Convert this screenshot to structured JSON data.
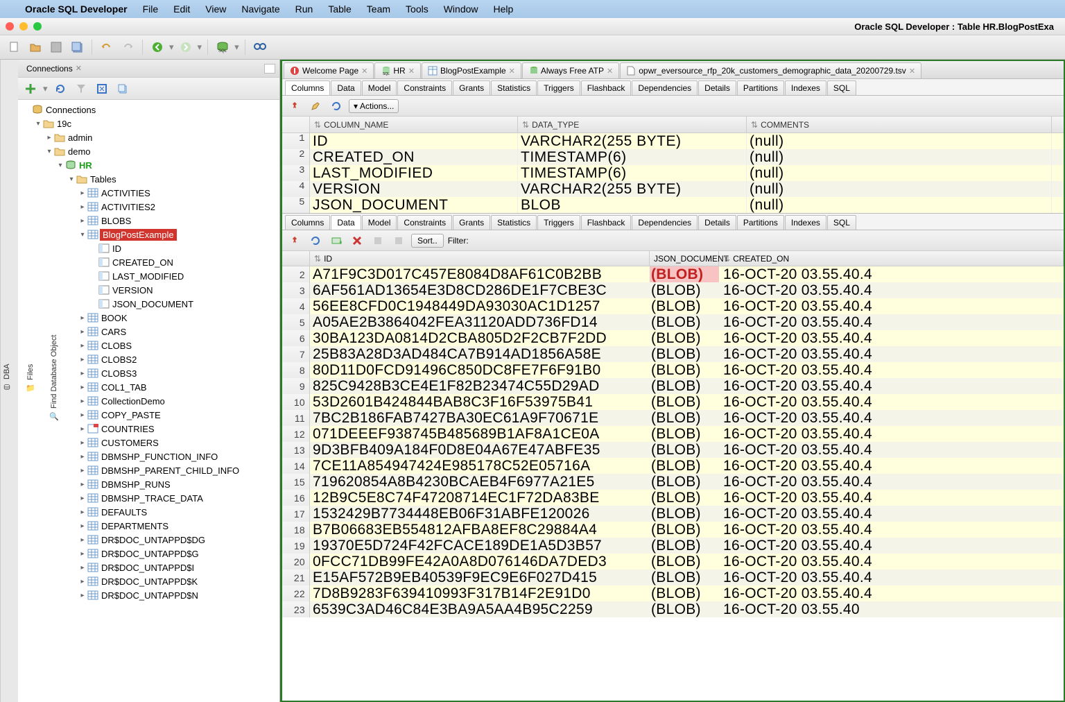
{
  "menubar": {
    "app": "Oracle SQL Developer",
    "items": [
      "File",
      "Edit",
      "View",
      "Navigate",
      "Run",
      "Table",
      "Team",
      "Tools",
      "Window",
      "Help"
    ]
  },
  "window": {
    "title": "Oracle SQL Developer : Table HR.BlogPostExa"
  },
  "leftRail": [
    "Find Database Object",
    "Files",
    "DBA"
  ],
  "connectionsPanel": {
    "title": "Connections"
  },
  "tree": [
    {
      "d": 0,
      "tw": "",
      "icon": "db",
      "label": "Connections",
      "cls": ""
    },
    {
      "d": 1,
      "tw": "▾",
      "icon": "folder",
      "label": "19c"
    },
    {
      "d": 2,
      "tw": "▸",
      "icon": "folder",
      "label": "admin"
    },
    {
      "d": 2,
      "tw": "▾",
      "icon": "folder",
      "label": "demo"
    },
    {
      "d": 3,
      "tw": "▾",
      "icon": "schema",
      "label": "HR",
      "cls": "schema-label"
    },
    {
      "d": 4,
      "tw": "▾",
      "icon": "folder-tbl",
      "label": "Tables"
    },
    {
      "d": 5,
      "tw": "▸",
      "icon": "table",
      "label": "ACTIVITIES"
    },
    {
      "d": 5,
      "tw": "▸",
      "icon": "table",
      "label": "ACTIVITIES2"
    },
    {
      "d": 5,
      "tw": "▸",
      "icon": "table",
      "label": "BLOBS"
    },
    {
      "d": 5,
      "tw": "▾",
      "icon": "table",
      "label": "BlogPostExample",
      "sel": true
    },
    {
      "d": 6,
      "tw": "",
      "icon": "col",
      "label": "ID"
    },
    {
      "d": 6,
      "tw": "",
      "icon": "col",
      "label": "CREATED_ON"
    },
    {
      "d": 6,
      "tw": "",
      "icon": "col",
      "label": "LAST_MODIFIED"
    },
    {
      "d": 6,
      "tw": "",
      "icon": "col",
      "label": "VERSION"
    },
    {
      "d": 6,
      "tw": "",
      "icon": "col",
      "label": "JSON_DOCUMENT"
    },
    {
      "d": 5,
      "tw": "▸",
      "icon": "table",
      "label": "BOOK"
    },
    {
      "d": 5,
      "tw": "▸",
      "icon": "table",
      "label": "CARS"
    },
    {
      "d": 5,
      "tw": "▸",
      "icon": "table",
      "label": "CLOBS"
    },
    {
      "d": 5,
      "tw": "▸",
      "icon": "table",
      "label": "CLOBS2"
    },
    {
      "d": 5,
      "tw": "▸",
      "icon": "table",
      "label": "CLOBS3"
    },
    {
      "d": 5,
      "tw": "▸",
      "icon": "table",
      "label": "COL1_TAB"
    },
    {
      "d": 5,
      "tw": "▸",
      "icon": "table",
      "label": "CollectionDemo"
    },
    {
      "d": 5,
      "tw": "▸",
      "icon": "table",
      "label": "COPY_PASTE"
    },
    {
      "d": 5,
      "tw": "▸",
      "icon": "table-flag",
      "label": "COUNTRIES"
    },
    {
      "d": 5,
      "tw": "▸",
      "icon": "table",
      "label": "CUSTOMERS"
    },
    {
      "d": 5,
      "tw": "▸",
      "icon": "table",
      "label": "DBMSHP_FUNCTION_INFO"
    },
    {
      "d": 5,
      "tw": "▸",
      "icon": "table",
      "label": "DBMSHP_PARENT_CHILD_INFO"
    },
    {
      "d": 5,
      "tw": "▸",
      "icon": "table",
      "label": "DBMSHP_RUNS"
    },
    {
      "d": 5,
      "tw": "▸",
      "icon": "table",
      "label": "DBMSHP_TRACE_DATA"
    },
    {
      "d": 5,
      "tw": "▸",
      "icon": "table",
      "label": "DEFAULTS"
    },
    {
      "d": 5,
      "tw": "▸",
      "icon": "table",
      "label": "DEPARTMENTS"
    },
    {
      "d": 5,
      "tw": "▸",
      "icon": "table",
      "label": "DR$DOC_UNTAPPD$DG"
    },
    {
      "d": 5,
      "tw": "▸",
      "icon": "table",
      "label": "DR$DOC_UNTAPPD$G"
    },
    {
      "d": 5,
      "tw": "▸",
      "icon": "table",
      "label": "DR$DOC_UNTAPPD$I"
    },
    {
      "d": 5,
      "tw": "▸",
      "icon": "table",
      "label": "DR$DOC_UNTAPPD$K"
    },
    {
      "d": 5,
      "tw": "▸",
      "icon": "table",
      "label": "DR$DOC_UNTAPPD$N"
    }
  ],
  "editorTabs": [
    {
      "icon": "welcome",
      "label": "Welcome Page"
    },
    {
      "icon": "sql",
      "label": "HR"
    },
    {
      "icon": "table",
      "label": "BlogPostExample"
    },
    {
      "icon": "sql-green",
      "label": "Always Free ATP"
    },
    {
      "icon": "file",
      "label": "opwr_eversource_rfp_20k_customers_demographic_data_20200729.tsv"
    }
  ],
  "subTabs": [
    "Columns",
    "Data",
    "Model",
    "Constraints",
    "Grants",
    "Statistics",
    "Triggers",
    "Flashback",
    "Dependencies",
    "Details",
    "Partitions",
    "Indexes",
    "SQL"
  ],
  "colToolbar": {
    "actions": "Actions..."
  },
  "columnsHeader": [
    "COLUMN_NAME",
    "DATA_TYPE",
    "COMMENTS"
  ],
  "columnsRows": [
    {
      "n": 1,
      "name": "ID",
      "type": "VARCHAR2(255 BYTE)",
      "comm": "(null)"
    },
    {
      "n": 2,
      "name": "CREATED_ON",
      "type": "TIMESTAMP(6)",
      "comm": "(null)"
    },
    {
      "n": 3,
      "name": "LAST_MODIFIED",
      "type": "TIMESTAMP(6)",
      "comm": "(null)"
    },
    {
      "n": 4,
      "name": "VERSION",
      "type": "VARCHAR2(255 BYTE)",
      "comm": "(null)"
    },
    {
      "n": 5,
      "name": "JSON_DOCUMENT",
      "type": "BLOB",
      "comm": "(null)"
    }
  ],
  "dataToolbar": {
    "sort": "Sort..",
    "filterLabel": "Filter:",
    "filterValue": ""
  },
  "dataHeader": [
    "ID",
    "JSON_DOCUMENT",
    "CREATED_ON"
  ],
  "dataRows": [
    {
      "n": 2,
      "id": "A71F9C3D017C457E8084D8AF61C0B2BB",
      "json": "(BLOB)",
      "sel": true,
      "created": "16-OCT-20 03.55.40.4"
    },
    {
      "n": 3,
      "id": "6AF561AD13654E3D8CD286DE1F7CBE3C",
      "json": "(BLOB)",
      "created": "16-OCT-20 03.55.40.4"
    },
    {
      "n": 4,
      "id": "56EE8CFD0C1948449DA93030AC1D1257",
      "json": "(BLOB)",
      "created": "16-OCT-20 03.55.40.4"
    },
    {
      "n": 5,
      "id": "A05AE2B3864042FEA31120ADD736FD14",
      "json": "(BLOB)",
      "created": "16-OCT-20 03.55.40.4"
    },
    {
      "n": 6,
      "id": "30BA123DA0814D2CBA805D2F2CB7F2DD",
      "json": "(BLOB)",
      "created": "16-OCT-20 03.55.40.4"
    },
    {
      "n": 7,
      "id": "25B83A28D3AD484CA7B914AD1856A58E",
      "json": "(BLOB)",
      "created": "16-OCT-20 03.55.40.4"
    },
    {
      "n": 8,
      "id": "80D11D0FCD91496C850DC8FE7F6F91B0",
      "json": "(BLOB)",
      "created": "16-OCT-20 03.55.40.4"
    },
    {
      "n": 9,
      "id": "825C9428B3CE4E1F82B23474C55D29AD",
      "json": "(BLOB)",
      "created": "16-OCT-20 03.55.40.4"
    },
    {
      "n": 10,
      "id": "53D2601B424844BAB8C3F16F53975B41",
      "json": "(BLOB)",
      "created": "16-OCT-20 03.55.40.4"
    },
    {
      "n": 11,
      "id": "7BC2B186FAB7427BA30EC61A9F70671E",
      "json": "(BLOB)",
      "created": "16-OCT-20 03.55.40.4"
    },
    {
      "n": 12,
      "id": "071DEEEF938745B485689B1AF8A1CE0A",
      "json": "(BLOB)",
      "created": "16-OCT-20 03.55.40.4"
    },
    {
      "n": 13,
      "id": "9D3BFB409A184F0D8E04A67E47ABFE35",
      "json": "(BLOB)",
      "created": "16-OCT-20 03.55.40.4"
    },
    {
      "n": 14,
      "id": "7CE11A854947424E985178C52E05716A",
      "json": "(BLOB)",
      "created": "16-OCT-20 03.55.40.4"
    },
    {
      "n": 15,
      "id": "719620854A8B4230BCAEB4F6977A21E5",
      "json": "(BLOB)",
      "created": "16-OCT-20 03.55.40.4"
    },
    {
      "n": 16,
      "id": "12B9C5E8C74F47208714EC1F72DA83BE",
      "json": "(BLOB)",
      "created": "16-OCT-20 03.55.40.4"
    },
    {
      "n": 17,
      "id": "1532429B7734448EB06F31ABFE120026",
      "json": "(BLOB)",
      "created": "16-OCT-20 03.55.40.4"
    },
    {
      "n": 18,
      "id": "B7B06683EB554812AFBA8EF8C29884A4",
      "json": "(BLOB)",
      "created": "16-OCT-20 03.55.40.4"
    },
    {
      "n": 19,
      "id": "19370E5D724F42FCACE189DE1A5D3B57",
      "json": "(BLOB)",
      "created": "16-OCT-20 03.55.40.4"
    },
    {
      "n": 20,
      "id": "0FCC71DB99FE42A0A8D076146DA7DED3",
      "json": "(BLOB)",
      "created": "16-OCT-20 03.55.40.4"
    },
    {
      "n": 21,
      "id": "E15AF572B9EB40539F9EC9E6F027D415",
      "json": "(BLOB)",
      "created": "16-OCT-20 03.55.40.4"
    },
    {
      "n": 22,
      "id": "7D8B9283F639410993F317B14F2E91D0",
      "json": "(BLOB)",
      "created": "16-OCT-20 03.55.40.4"
    },
    {
      "n": 23,
      "id": "6539C3AD46C84E3BA9A5AA4B95C2259",
      "json": "(BLOB)",
      "created": "16-OCT-20 03.55.40"
    }
  ]
}
